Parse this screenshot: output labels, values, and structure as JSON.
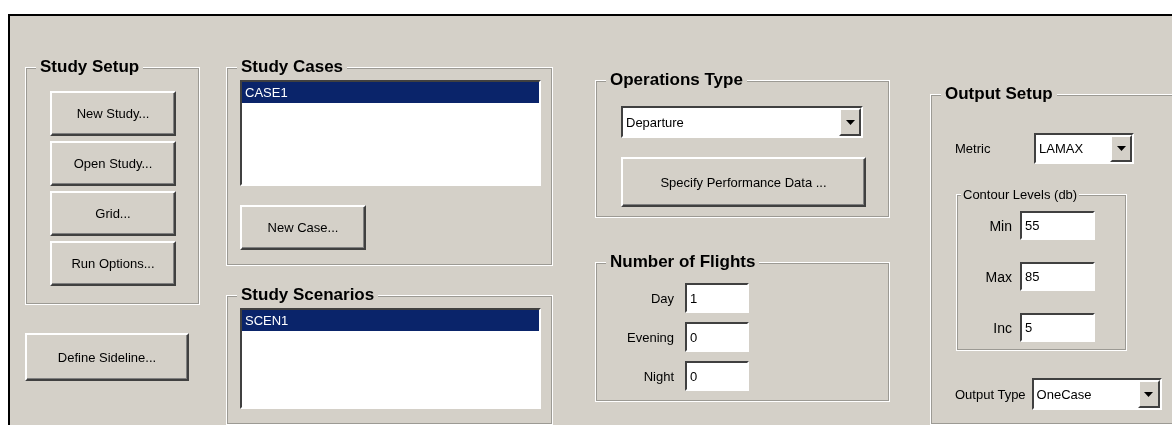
{
  "study_setup": {
    "title": "Study Setup",
    "buttons": [
      "New Study...",
      "Open Study...",
      "Grid...",
      "Run Options..."
    ]
  },
  "define_sideline_button": "Define Sideline...",
  "study_cases": {
    "title": "Study Cases",
    "items": [
      {
        "label": "CASE1",
        "selected": true
      }
    ],
    "button": "New Case..."
  },
  "study_scenarios": {
    "title": "Study Scenarios",
    "items": [
      {
        "label": "SCEN1",
        "selected": true
      }
    ]
  },
  "operations_type": {
    "title": "Operations Type",
    "value": "Departure",
    "button": "Specify Performance Data ..."
  },
  "number_of_flights": {
    "title": "Number of Flights",
    "fields": [
      {
        "label": "Day",
        "value": "1"
      },
      {
        "label": "Evening",
        "value": "0"
      },
      {
        "label": "Night",
        "value": "0"
      }
    ]
  },
  "output_setup": {
    "title": "Output Setup",
    "metric": {
      "label": "Metric",
      "value": "LAMAX"
    },
    "contour_levels": {
      "title": "Contour Levels (db)",
      "fields": [
        {
          "label": "Min",
          "value": "55"
        },
        {
          "label": "Max",
          "value": "85"
        },
        {
          "label": "Inc",
          "value": "5"
        }
      ]
    },
    "output_type": {
      "label": "Output Type",
      "value": "OneCase"
    }
  }
}
